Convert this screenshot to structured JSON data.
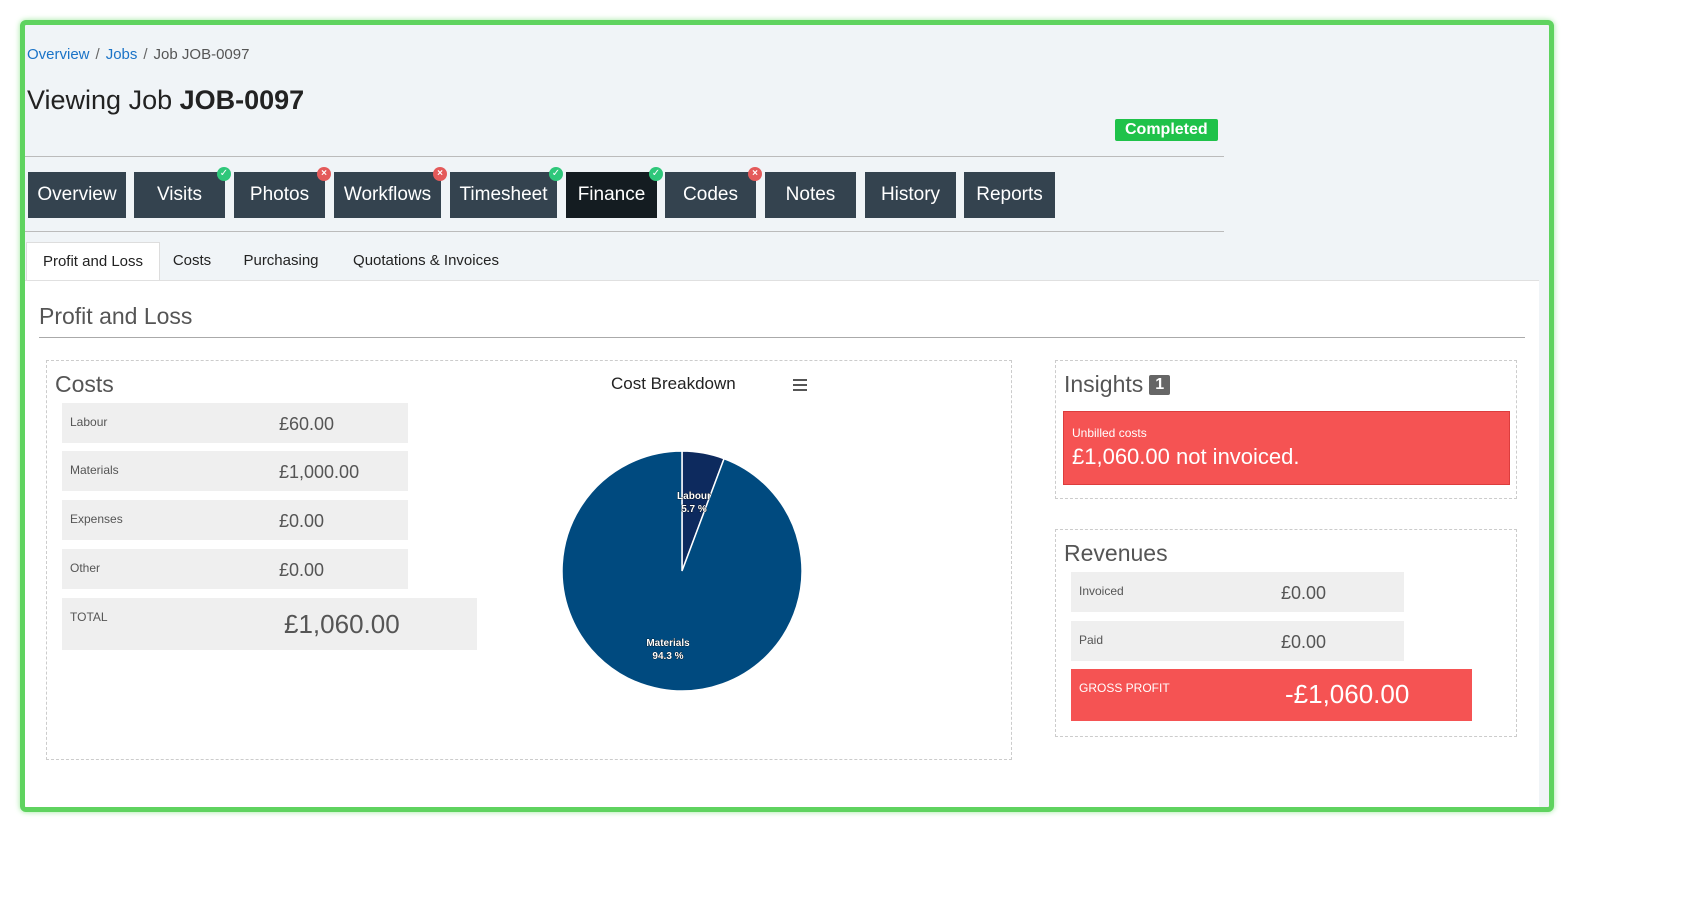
{
  "breadcrumb": {
    "items": [
      "Overview",
      "Jobs",
      "Job JOB-0097"
    ],
    "separator": "/"
  },
  "title": {
    "prefix": "Viewing Job",
    "job_id": "JOB-0097"
  },
  "status": {
    "label": "Completed",
    "color": "#1fc24a"
  },
  "tabs": [
    {
      "label": "Overview",
      "indicator": ""
    },
    {
      "label": "Visits",
      "indicator": "ok"
    },
    {
      "label": "Photos",
      "indicator": "bad"
    },
    {
      "label": "Workflows",
      "indicator": "bad"
    },
    {
      "label": "Timesheet",
      "indicator": "ok"
    },
    {
      "label": "Finance",
      "indicator": "ok",
      "active": true
    },
    {
      "label": "Codes",
      "indicator": "bad"
    },
    {
      "label": "Notes",
      "indicator": ""
    },
    {
      "label": "History",
      "indicator": ""
    },
    {
      "label": "Reports",
      "indicator": ""
    }
  ],
  "subtabs": [
    "Profit and Loss",
    "Costs",
    "Purchasing",
    "Quotations & Invoices"
  ],
  "section": {
    "title": "Profit and Loss"
  },
  "costs": {
    "title": "Costs",
    "rows": [
      {
        "label": "Labour",
        "value": "£60.00"
      },
      {
        "label": "Materials",
        "value": "£1,000.00"
      },
      {
        "label": "Expenses",
        "value": "£0.00"
      },
      {
        "label": "Other",
        "value": "£0.00"
      }
    ],
    "total": {
      "label": "TOTAL",
      "value": "£1,060.00"
    }
  },
  "chart_data": {
    "type": "pie",
    "title": "Cost Breakdown",
    "slices": [
      {
        "name": "Labour",
        "value": 5.7,
        "label": "5.7 %",
        "color": "#0d2a5e"
      },
      {
        "name": "Materials",
        "value": 94.3,
        "label": "94.3 %",
        "color": "#004a7f"
      }
    ]
  },
  "insights": {
    "title": "Insights",
    "count": "1",
    "items": [
      {
        "title": "Unbilled costs",
        "message": "£1,060.00 not invoiced."
      }
    ]
  },
  "revenues": {
    "title": "Revenues",
    "rows": [
      {
        "label": "Invoiced",
        "value": "£0.00"
      },
      {
        "label": "Paid",
        "value": "£0.00"
      }
    ],
    "gross": {
      "label": "GROSS PROFIT",
      "value": "-£1,060.00"
    }
  }
}
